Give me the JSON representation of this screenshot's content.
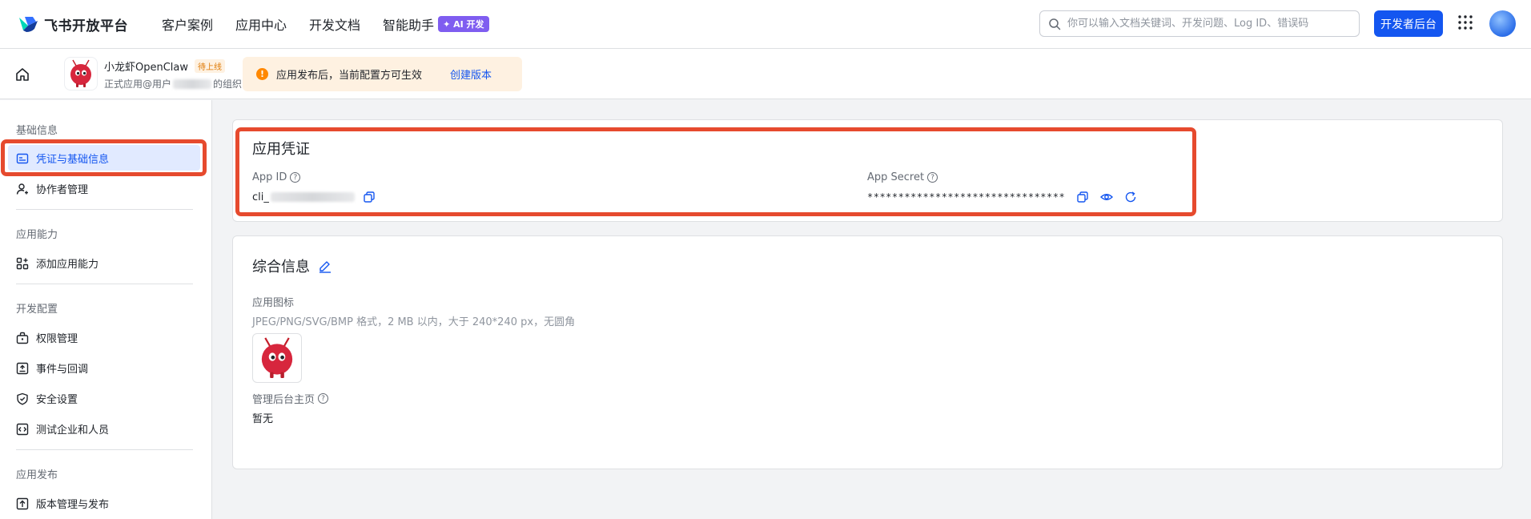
{
  "topbar": {
    "logo_text": "飞书开放平台",
    "nav": [
      {
        "label": "客户案例"
      },
      {
        "label": "应用中心"
      },
      {
        "label": "开发文档"
      },
      {
        "label": "智能助手"
      }
    ],
    "ai_badge": "✦ AI 开发",
    "search_placeholder": "你可以输入文档关键词、开发问题、Log ID、错误码",
    "dev_button": "开发者后台"
  },
  "appbar": {
    "app_name": "小龙虾OpenClaw",
    "status_badge": "待上线",
    "app_sub_prefix": "正式应用@用户",
    "app_sub_suffix": "的组织",
    "notice_icon": "!",
    "notice_text": "应用发布后，当前配置方可生效",
    "notice_link": "创建版本"
  },
  "sidebar": {
    "groups": [
      {
        "label": "基础信息"
      },
      {
        "label": "应用能力"
      },
      {
        "label": "开发配置"
      },
      {
        "label": "应用发布"
      }
    ],
    "items": [
      {
        "label": "凭证与基础信息",
        "icon": "credential-icon"
      },
      {
        "label": "协作者管理",
        "icon": "user-add-icon"
      },
      {
        "label": "添加应用能力",
        "icon": "apps-icon"
      },
      {
        "label": "权限管理",
        "icon": "lock-briefcase-icon"
      },
      {
        "label": "事件与回调",
        "icon": "event-icon"
      },
      {
        "label": "安全设置",
        "icon": "shield-icon"
      },
      {
        "label": "测试企业和人员",
        "icon": "code-icon"
      },
      {
        "label": "版本管理与发布",
        "icon": "upload-icon"
      }
    ]
  },
  "credentials": {
    "title": "应用凭证",
    "app_id_label": "App ID",
    "app_id_value": "cli_",
    "app_secret_label": "App Secret",
    "app_secret_value": "********************************"
  },
  "overview": {
    "title": "综合信息",
    "icon_label": "应用图标",
    "icon_hint": "JPEG/PNG/SVG/BMP 格式，2 MB 以内，大于 240*240 px，无圆角",
    "homepage_label": "管理后台主页",
    "homepage_value": "暂无"
  },
  "colors": {
    "accent": "#1456f0",
    "highlight_box": "#e64a2e",
    "ai_badge": "#7f5df0",
    "warning": "#ff8800"
  }
}
